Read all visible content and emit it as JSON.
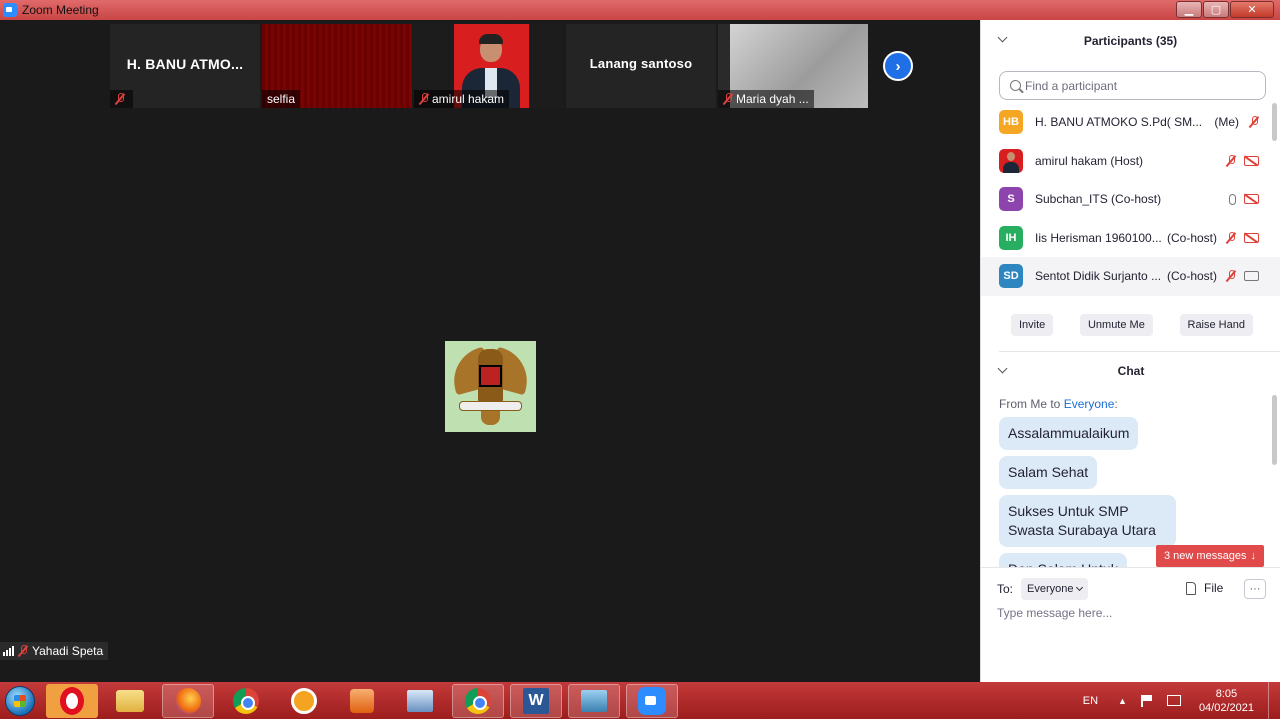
{
  "window": {
    "title": "Zoom Meeting",
    "controls": {
      "minimize": "▁",
      "maximize": "▢",
      "close": "✕"
    }
  },
  "video_strip": {
    "tiles": [
      {
        "big_name": "H. BANU ATMO...",
        "label": "",
        "muted": true,
        "kind": "name"
      },
      {
        "big_name": "",
        "label": "selfia",
        "muted": false,
        "kind": "red"
      },
      {
        "big_name": "",
        "label": "amirul hakam",
        "muted": true,
        "kind": "photo"
      },
      {
        "big_name": "Lanang santoso",
        "label": "",
        "muted": false,
        "kind": "name"
      },
      {
        "big_name": "",
        "label": "Maria dyah ...",
        "muted": true,
        "kind": "gray"
      }
    ],
    "next_label": "›"
  },
  "main_video": {
    "speaker_label": "Yahadi Speta"
  },
  "participants": {
    "title": "Participants (35)",
    "search_placeholder": "Find a participant",
    "list": [
      {
        "initials": "HB",
        "color": "#f5a623",
        "name": "H. BANU ATMOKO     S.Pd( SM...",
        "role": "(Me)",
        "mic": "off",
        "cam": "none"
      },
      {
        "initials": "",
        "color": "#d81e1e",
        "name": "amirul hakam (Host)",
        "role": "",
        "mic": "off",
        "cam": "off",
        "photo": true
      },
      {
        "initials": "S",
        "color": "#8e44ad",
        "name": "Subchan_ITS (Co-host)",
        "role": "",
        "mic": "on",
        "cam": "off"
      },
      {
        "initials": "IH",
        "color": "#27ae60",
        "name": "Iis Herisman 1960100...",
        "role": "(Co-host)",
        "mic": "off",
        "cam": "off"
      },
      {
        "initials": "SD",
        "color": "#2e86c1",
        "name": "Sentot Didik Surjanto ...",
        "role": "(Co-host)",
        "mic": "off",
        "cam": "on"
      }
    ],
    "buttons": {
      "invite": "Invite",
      "unmute": "Unmute Me",
      "raise_hand": "Raise Hand"
    }
  },
  "chat": {
    "title": "Chat",
    "from_prefix": "From Me to ",
    "from_target": "Everyone",
    "from_suffix": ":",
    "messages": [
      "Assalammualaikum",
      "Salam Sehat",
      "Sukses Untuk SMP Swasta Surabaya Utara",
      "Dan Salam Untuk"
    ],
    "new_messages": "3 new messages",
    "to_label": "To:",
    "to_value": "Everyone",
    "file_label": "File",
    "more_label": "···",
    "input_placeholder": "Type message here..."
  },
  "taskbar": {
    "word_letter": "W",
    "language": "EN",
    "time": "8:05",
    "date": "04/02/2021"
  }
}
